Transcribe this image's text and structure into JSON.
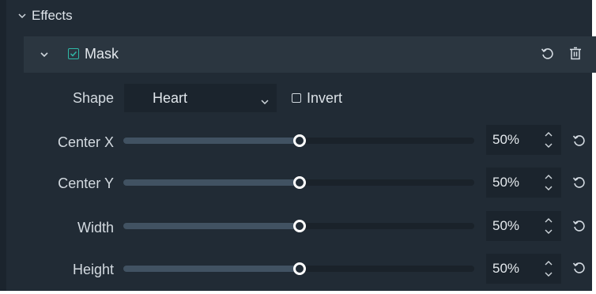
{
  "effects": {
    "title": "Effects"
  },
  "mask": {
    "label": "Mask",
    "enabled": true
  },
  "shape": {
    "label": "Shape",
    "value": "Heart"
  },
  "invert": {
    "label": "Invert",
    "checked": false
  },
  "params": [
    {
      "label": "Center X",
      "value": "50%",
      "level": 0.5
    },
    {
      "label": "Center Y",
      "value": "50%",
      "level": 0.5
    },
    {
      "label": "Width",
      "value": "50%",
      "level": 0.5
    },
    {
      "label": "Height",
      "value": "50%",
      "level": 0.5
    }
  ],
  "colors": {
    "accent": "#2fb8a6",
    "panel": "#212b35",
    "row": "#2b3640",
    "field": "#1b242d"
  },
  "icons": [
    "chevron-down-icon",
    "checkbox-checked-icon",
    "reset-icon",
    "trash-icon",
    "spin-up-icon",
    "spin-down-icon"
  ]
}
